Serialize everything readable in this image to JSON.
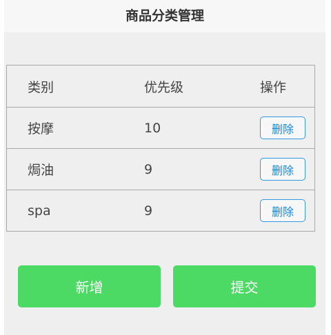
{
  "header": {
    "title": "商品分类管理"
  },
  "table": {
    "columns": [
      "类别",
      "优先级",
      "操作"
    ],
    "rows": [
      {
        "category": "按摩",
        "priority": "10",
        "action": "删除"
      },
      {
        "category": "焗油",
        "priority": "9",
        "action": "删除"
      },
      {
        "category": "spa",
        "priority": "9",
        "action": "删除"
      }
    ]
  },
  "actions": {
    "add_label": "新增",
    "submit_label": "提交"
  },
  "colors": {
    "primary_green": "#4cd964",
    "link_blue": "#1e88d2"
  }
}
